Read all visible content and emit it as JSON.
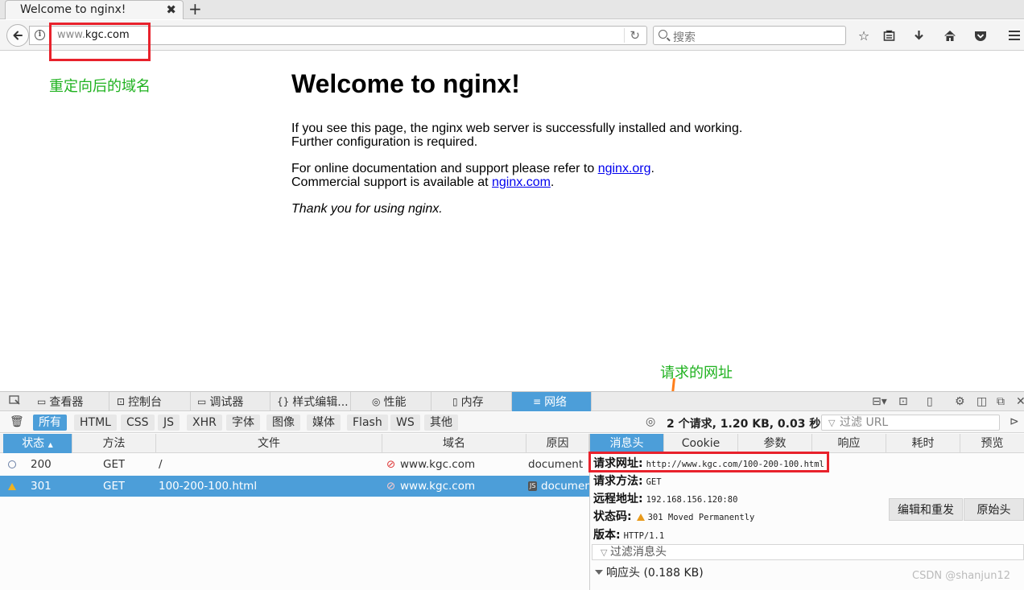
{
  "browser": {
    "tab_title": "Welcome to nginx!",
    "tab_close": "✖",
    "new_tab": "+",
    "url_prefix": "www.",
    "url_domain": "kgc.com",
    "search_placeholder": "搜索"
  },
  "annotations": {
    "redirect_domain": "重定向后的域名",
    "request_url_note": "请求的网址",
    "accent_red": "#e8222c",
    "accent_green": "#1fb21f",
    "accent_orange": "#ff7e1a"
  },
  "page": {
    "heading": "Welcome to nginx!",
    "p1_line1": "If you see this page, the nginx web server is successfully installed and working.",
    "p1_line2": "Further configuration is required.",
    "p2_pre": "For online documentation and support please refer to ",
    "p2_link": "nginx.org",
    "p2_post": ".",
    "p3_pre": "Commercial support is available at ",
    "p3_link": "nginx.com",
    "p3_post": ".",
    "thanks": "Thank you for using nginx."
  },
  "devtools": {
    "tabs": [
      {
        "label": "查看器",
        "icon": "inspector-icon"
      },
      {
        "label": "控制台",
        "icon": "console-icon"
      },
      {
        "label": "调试器",
        "icon": "debugger-icon"
      },
      {
        "label": "样式编辑...",
        "icon": "style-editor-icon"
      },
      {
        "label": "性能",
        "icon": "performance-icon"
      },
      {
        "label": "内存",
        "icon": "memory-icon"
      },
      {
        "label": "网络",
        "icon": "network-icon"
      }
    ],
    "filters": [
      "所有",
      "HTML",
      "CSS",
      "JS",
      "XHR",
      "字体",
      "图像",
      "媒体",
      "Flash",
      "WS",
      "其他"
    ],
    "summary": "2 个请求, 1.20 KB, 0.03 秒",
    "filter_url_placeholder": "过滤 URL",
    "columns": [
      "状态",
      "方法",
      "文件",
      "域名",
      "原因"
    ],
    "rows": [
      {
        "status": "200",
        "method": "GET",
        "file": "/",
        "domain": "www.kgc.com",
        "cause": "document"
      },
      {
        "status": "301",
        "method": "GET",
        "file": "100-200-100.html",
        "domain": "www.kgc.com",
        "cause": "documen"
      }
    ],
    "detail_tabs": [
      "消息头",
      "Cookie",
      "参数",
      "响应",
      "耗时",
      "预览"
    ],
    "detail": {
      "request_url_label": "请求网址:",
      "request_url": "http://www.kgc.com/100-200-100.html",
      "method_label": "请求方法:",
      "method": "GET",
      "remote_label": "远程地址:",
      "remote": "192.168.156.120:80",
      "status_label": "状态码:",
      "status": "301  Moved  Permanently",
      "version_label": "版本:",
      "version": "HTTP/1.1",
      "edit_resend": "编辑和重发",
      "raw_headers": "原始头",
      "filter_headers_placeholder": "过滤消息头",
      "response_headers": "响应头 (0.188 KB)"
    }
  },
  "watermark": "CSDN @shanjun12"
}
